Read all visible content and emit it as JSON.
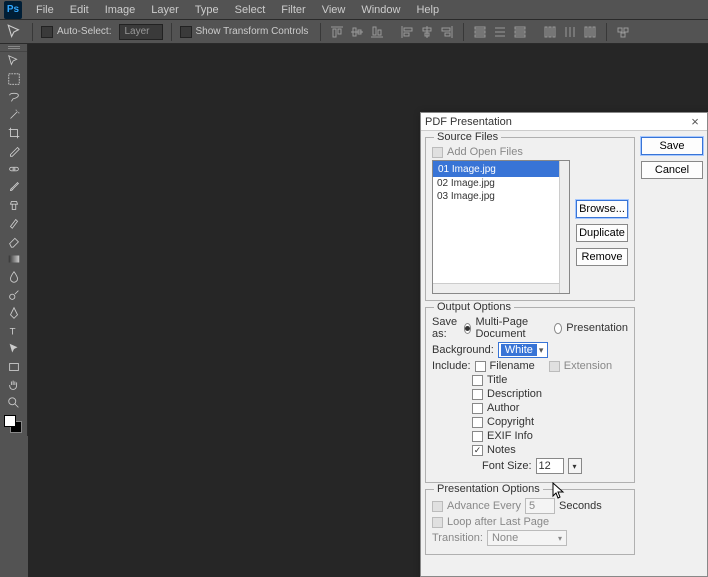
{
  "menu": [
    "File",
    "Edit",
    "Image",
    "Layer",
    "Type",
    "Select",
    "Filter",
    "View",
    "Window",
    "Help"
  ],
  "options": {
    "auto_select": "Auto-Select:",
    "layer": "Layer",
    "show_transform": "Show Transform Controls"
  },
  "dialog": {
    "title": "PDF Presentation",
    "close": "×",
    "save": "Save",
    "cancel": "Cancel",
    "source_files": {
      "legend": "Source Files",
      "add_open": "Add Open Files",
      "items": [
        "01 Image.jpg",
        "02 Image.jpg",
        "03 Image.jpg"
      ],
      "browse": "Browse...",
      "duplicate": "Duplicate",
      "remove": "Remove"
    },
    "output": {
      "legend": "Output Options",
      "save_as": "Save as:",
      "multipage": "Multi-Page Document",
      "presentation": "Presentation",
      "background": "Background:",
      "bg_value": "White",
      "include": "Include:",
      "filename": "Filename",
      "extension": "Extension",
      "title": "Title",
      "description": "Description",
      "author": "Author",
      "copyright": "Copyright",
      "exif": "EXIF Info",
      "notes": "Notes",
      "font_size": "Font Size:",
      "font_size_val": "12"
    },
    "pres": {
      "legend": "Presentation Options",
      "advance": "Advance Every",
      "advance_val": "5",
      "seconds": "Seconds",
      "loop": "Loop after Last Page",
      "transition": "Transition:",
      "transition_val": "None"
    }
  }
}
